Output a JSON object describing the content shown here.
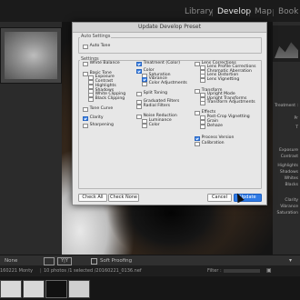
{
  "app": {
    "modules": [
      "Library",
      "Develop",
      "Map",
      "Book"
    ],
    "active_module": "Develop"
  },
  "right_panel": {
    "labels": [
      "Treatment :",
      "Pr",
      "T",
      "Exposure",
      "Contrast",
      "Highlights",
      "Shadows",
      "Whites",
      "Blacks",
      "Clarity",
      "Vibrance",
      "Saturation"
    ]
  },
  "toolbar": {
    "view_mode": "None",
    "soft_proofing": "Soft Proofing"
  },
  "filmstrip_bar": {
    "folder": "160221 Monty",
    "status": "10 photos /1 selected /20160221_0136.nef",
    "filter_label": "Filter :"
  },
  "dialog": {
    "title": "Update Develop Preset",
    "auto_settings": {
      "legend": "Auto Settings",
      "items": [
        {
          "label": "Auto Tone",
          "checked": false
        }
      ]
    },
    "settings": {
      "legend": "Settings",
      "column1": [
        {
          "label": "White Balance",
          "checked": false,
          "indent": 0
        },
        {
          "label": "Basic Tone",
          "checked": false,
          "indent": 0
        },
        {
          "label": "Exposure",
          "checked": false,
          "indent": 1
        },
        {
          "label": "Contrast",
          "checked": false,
          "indent": 1
        },
        {
          "label": "Highlights",
          "checked": false,
          "indent": 1
        },
        {
          "label": "Shadows",
          "checked": false,
          "indent": 1
        },
        {
          "label": "White Clipping",
          "checked": false,
          "indent": 1
        },
        {
          "label": "Black Clipping",
          "checked": false,
          "indent": 1
        },
        {
          "label": "Tone Curve",
          "checked": false,
          "indent": 0
        },
        {
          "label": "Clarity",
          "checked": true,
          "indent": 0
        },
        {
          "label": "Sharpening",
          "checked": false,
          "indent": 0
        }
      ],
      "column2": [
        {
          "label": "Treatment (Color)",
          "checked": true,
          "indent": 0
        },
        {
          "label": "Color",
          "checked": true,
          "indent": 0
        },
        {
          "label": "Saturation",
          "checked": false,
          "indent": 1
        },
        {
          "label": "Vibrance",
          "checked": true,
          "indent": 1
        },
        {
          "label": "Color Adjustments",
          "checked": false,
          "indent": 1
        },
        {
          "label": "Split Toning",
          "checked": false,
          "indent": 0
        },
        {
          "label": "Graduated Filters",
          "checked": false,
          "indent": 0
        },
        {
          "label": "Radial Filters",
          "checked": false,
          "indent": 0
        },
        {
          "label": "Noise Reduction",
          "checked": false,
          "indent": 0
        },
        {
          "label": "Luminance",
          "checked": false,
          "indent": 1
        },
        {
          "label": "Color",
          "checked": false,
          "indent": 1
        }
      ],
      "column3": [
        {
          "label": "Lens Corrections",
          "checked": false,
          "indent": 0
        },
        {
          "label": "Lens Profile Corrections",
          "checked": false,
          "indent": 1
        },
        {
          "label": "Chromatic Aberration",
          "checked": false,
          "indent": 1
        },
        {
          "label": "Lens Distortion",
          "checked": false,
          "indent": 1
        },
        {
          "label": "Lens Vignetting",
          "checked": false,
          "indent": 1
        },
        {
          "label": "Transform",
          "checked": false,
          "indent": 0
        },
        {
          "label": "Upright Mode",
          "checked": false,
          "indent": 1
        },
        {
          "label": "Upright Transforms",
          "checked": false,
          "indent": 1
        },
        {
          "label": "Transform Adjustments",
          "checked": false,
          "indent": 1
        },
        {
          "label": "Effects",
          "checked": false,
          "indent": 0
        },
        {
          "label": "Post-Crop Vignetting",
          "checked": false,
          "indent": 1
        },
        {
          "label": "Grain",
          "checked": false,
          "indent": 1
        },
        {
          "label": "Dehaze",
          "checked": false,
          "indent": 1
        },
        {
          "label": "Process Version",
          "checked": true,
          "indent": 0
        },
        {
          "label": "Calibration",
          "checked": false,
          "indent": 0
        }
      ]
    },
    "buttons": {
      "check_all": "Check All",
      "check_none": "Check None",
      "cancel": "Cancel",
      "update": "Update"
    }
  }
}
